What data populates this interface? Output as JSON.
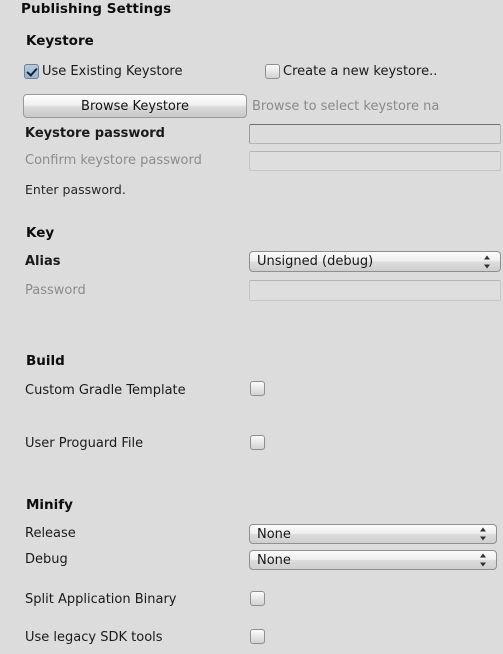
{
  "panel": {
    "title": "Publishing Settings",
    "background_color": "#dcdcdc"
  },
  "keystore": {
    "section_title": "Keystore",
    "use_existing_label": "Use Existing Keystore",
    "use_existing_checked": true,
    "create_new_label": "Create a new keystore..",
    "create_new_checked": false,
    "browse_button_label": "Browse Keystore",
    "browse_hint": "Browse to select keystore na",
    "password_label": "Keystore password",
    "password_value": "",
    "confirm_label": "Confirm keystore password",
    "confirm_value": "",
    "confirm_disabled": true,
    "help_text": "Enter password."
  },
  "key": {
    "section_title": "Key",
    "alias_label": "Alias",
    "alias_value": "Unsigned (debug)",
    "password_label": "Password",
    "password_value": "",
    "password_disabled": true
  },
  "build": {
    "section_title": "Build",
    "custom_gradle_label": "Custom Gradle Template",
    "custom_gradle_checked": false,
    "proguard_label": "User Proguard File",
    "proguard_checked": false
  },
  "minify": {
    "section_title": "Minify",
    "release_label": "Release",
    "release_value": "None",
    "debug_label": "Debug",
    "debug_value": "None",
    "split_binary_label": "Split Application Binary",
    "split_binary_checked": false,
    "legacy_sdk_label": "Use legacy SDK tools",
    "legacy_sdk_checked": false
  },
  "icons": {
    "dropdown_arrow": "updown-arrow-icon",
    "checkmark": "check-icon"
  }
}
